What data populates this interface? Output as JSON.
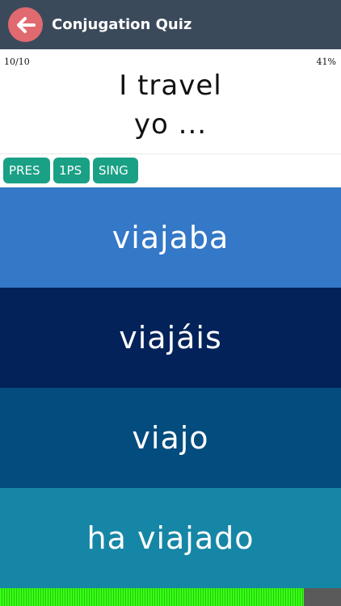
{
  "header": {
    "title": "Conjugation Quiz",
    "back_icon": "arrow-left-icon",
    "back_color": "#e06a70",
    "background": "#3b4a5a"
  },
  "status": {
    "progress": "10/10",
    "score": "41%"
  },
  "prompt": {
    "english": "I travel",
    "pronoun": "yo ..."
  },
  "tags": [
    "PRES",
    "1PS",
    "SING"
  ],
  "answers": [
    "viajaba",
    "viajáis",
    "viajo",
    "ha viajado"
  ],
  "timer": {
    "remaining_fraction": 0.89
  }
}
